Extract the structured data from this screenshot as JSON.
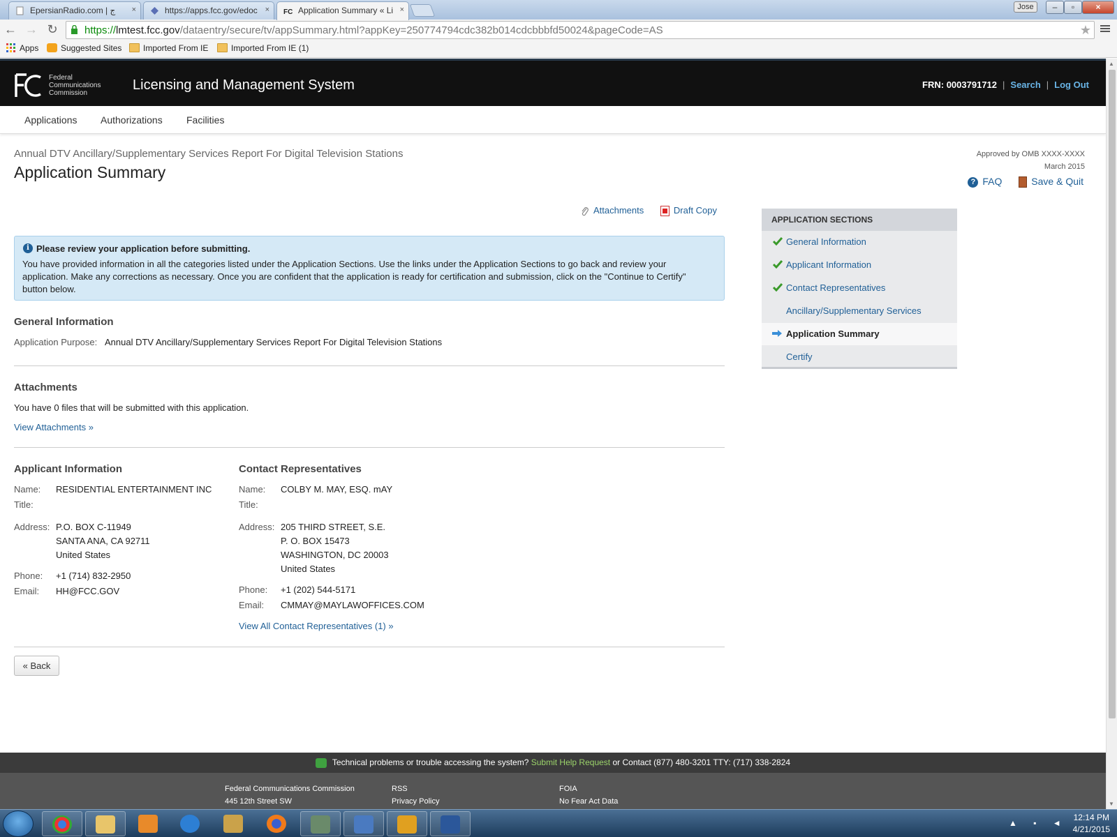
{
  "browser": {
    "tabs": [
      {
        "title": "EpersianRadio.com | ج",
        "close": "×"
      },
      {
        "title": "https://apps.fcc.gov/edoc",
        "close": "×"
      },
      {
        "title": "Application Summary « Li",
        "close": "×"
      }
    ],
    "user": "Jose",
    "url": {
      "scheme": "https://",
      "host": "lmtest.fcc.gov",
      "path": "/dataentry/secure/tv/appSummary.html?appKey=250774794cdc382b014cdcbbbfd50024&pageCode=AS"
    },
    "bookmarks": [
      "Apps",
      "Suggested Sites",
      "Imported From IE",
      "Imported From IE (1)"
    ]
  },
  "header": {
    "org_line1": "Federal",
    "org_line2": "Communications",
    "org_line3": "Commission",
    "title": "Licensing and Management System",
    "frn": "FRN: 0003791712",
    "search": "Search",
    "logout": "Log Out"
  },
  "nav": [
    "Applications",
    "Authorizations",
    "Facilities"
  ],
  "page": {
    "subtitle": "Annual DTV Ancillary/Supplementary Services Report For Digital Television Stations",
    "title": "Application Summary",
    "omb_line1": "Approved by OMB XXXX-XXXX",
    "omb_line2": "March 2015",
    "faq": "FAQ",
    "save_quit": "Save & Quit",
    "attachments_link": "Attachments",
    "draft_copy": "Draft Copy"
  },
  "alert": {
    "icon": "i",
    "heading": "Please review your application before submitting.",
    "body": "You have provided information in all the categories listed under the Application Sections. Use the links under the Application Sections to go back and review your application. Make any corrections as necessary. Once you are confident that the application is ready for certification and submission, click on the \"Continue to Certify\" button below."
  },
  "general": {
    "heading": "General Information",
    "purpose_label": "Application Purpose:",
    "purpose_value": "Annual DTV Ancillary/Supplementary Services Report For Digital Television Stations"
  },
  "attachments": {
    "heading": "Attachments",
    "text": "You have 0 files that will be submitted with this application.",
    "link": "View Attachments »"
  },
  "applicant": {
    "heading": "Applicant Information",
    "name_label": "Name:",
    "name": "RESIDENTIAL ENTERTAINMENT INC",
    "title_label": "Title:",
    "address_label": "Address:",
    "address": [
      "P.O. BOX C-11949",
      "SANTA ANA, CA 92711",
      "United States"
    ],
    "phone_label": "Phone:",
    "phone": "+1 (714) 832-2950",
    "email_label": "Email:",
    "email": "HH@FCC.GOV"
  },
  "contact": {
    "heading": "Contact Representatives",
    "name_label": "Name:",
    "name": "COLBY M. MAY, ESQ. mAY",
    "title_label": "Title:",
    "address_label": "Address:",
    "address": [
      "205 THIRD STREET, S.E.",
      "P. O. BOX 15473",
      "WASHINGTON, DC 20003",
      "United States"
    ],
    "phone_label": "Phone:",
    "phone": "+1 (202) 544-5171",
    "email_label": "Email:",
    "email": "CMMAY@MAYLAWOFFICES.COM",
    "link": "View All Contact Representatives (1) »"
  },
  "back": "« Back",
  "sidebar": {
    "heading": "APPLICATION SECTIONS",
    "items": [
      {
        "label": "General Information",
        "status": "complete"
      },
      {
        "label": "Applicant Information",
        "status": "complete"
      },
      {
        "label": "Contact Representatives",
        "status": "complete"
      },
      {
        "label": "Ancillary/Supplementary Services",
        "status": "none"
      },
      {
        "label": "Application Summary",
        "status": "current"
      },
      {
        "label": "Certify",
        "status": "none"
      }
    ]
  },
  "footer": {
    "help_prefix": "Technical problems or trouble accessing the system?",
    "help_link": "Submit Help Request",
    "help_suffix": "or Contact (877) 480-3201 TTY: (717) 338-2824",
    "col1": [
      "Federal Communications Commission",
      "445 12th Street SW"
    ],
    "col2": [
      "RSS",
      "Privacy Policy"
    ],
    "col3": [
      "FOIA",
      "No Fear Act Data"
    ]
  },
  "taskbar": {
    "time": "12:14 PM",
    "date": "4/21/2015"
  },
  "colors": {
    "header_bg": "#111111",
    "link": "#1f5f96",
    "alert_bg": "#d5e9f6",
    "check": "#3a9a2a"
  }
}
